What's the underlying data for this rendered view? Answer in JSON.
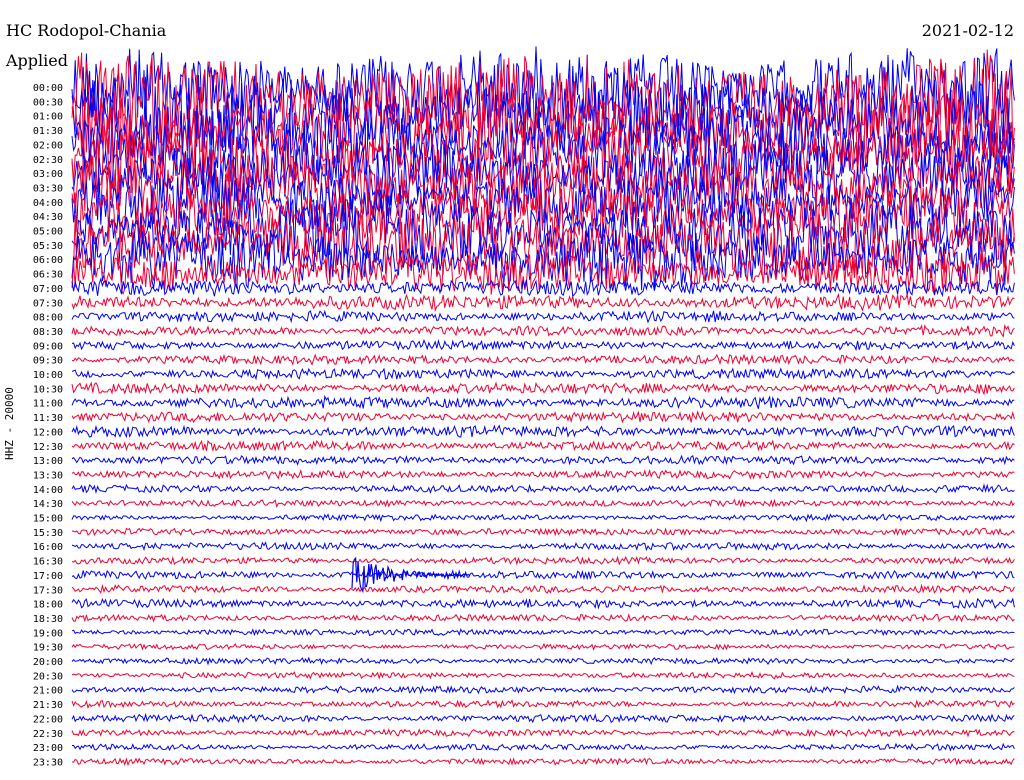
{
  "header": {
    "station": "HC Rodopol-Chania",
    "applied": "Applied",
    "date": "2021-02-12"
  },
  "chart_data": {
    "type": "line",
    "title": "HC Rodopol-Chania",
    "channel_label": "HHZ - 20000",
    "date": "2021-02-12",
    "row_labels": [
      "00:00",
      "00:30",
      "01:00",
      "01:30",
      "02:00",
      "02:30",
      "03:00",
      "03:30",
      "04:00",
      "04:30",
      "05:00",
      "05:30",
      "06:00",
      "06:30",
      "07:00",
      "07:30",
      "08:00",
      "08:30",
      "09:00",
      "09:30",
      "10:00",
      "10:30",
      "11:00",
      "11:30",
      "12:00",
      "12:30",
      "13:00",
      "13:30",
      "14:00",
      "14:30",
      "15:00",
      "15:30",
      "16:00",
      "16:30",
      "17:00",
      "17:30",
      "18:00",
      "18:30",
      "19:00",
      "19:30",
      "20:00",
      "20:30",
      "21:00",
      "21:30",
      "22:00",
      "22:30",
      "23:00",
      "23:30"
    ],
    "colors": {
      "even_rows": "#0000ee",
      "odd_rows": "#ee0033"
    },
    "relative_amplitude": [
      12,
      14,
      13,
      12,
      11,
      11,
      10,
      10,
      9,
      9,
      10,
      10,
      9,
      6,
      2.5,
      2.2,
      1.6,
      1.5,
      1.4,
      1.4,
      1.5,
      1.6,
      1.7,
      1.5,
      1.6,
      1.4,
      1.3,
      1.2,
      1.1,
      1.0,
      0.9,
      1.0,
      1.1,
      1.0,
      1.2,
      1.1,
      1.3,
      1.0,
      0.9,
      0.8,
      0.9,
      0.9,
      1.0,
      1.0,
      1.1,
      1.0,
      0.9,
      0.9
    ],
    "events": [
      {
        "row": "17:00",
        "label": "arrival",
        "relative_amplitude": 7
      }
    ]
  }
}
